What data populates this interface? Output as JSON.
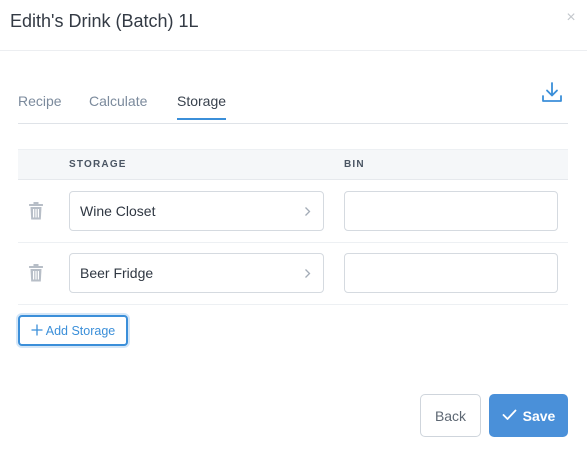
{
  "modal": {
    "title": "Edith's Drink (Batch) 1L",
    "close_glyph": "×"
  },
  "tabs": [
    {
      "label": "Recipe"
    },
    {
      "label": "Calculate"
    },
    {
      "label": "Storage",
      "active": true
    }
  ],
  "table": {
    "headers": {
      "storage": "STORAGE",
      "bin": "BIN"
    },
    "rows": [
      {
        "storage": "Wine Closet",
        "bin": ""
      },
      {
        "storage": "Beer Fridge",
        "bin": ""
      }
    ]
  },
  "actions": {
    "add_storage": "Add Storage",
    "back": "Back",
    "save": "Save"
  },
  "icons": {
    "download": "download-icon",
    "trash": "trash-icon",
    "chevron": "chevron-right-icon",
    "check": "check-icon",
    "plus": "plus-icon",
    "close": "close-icon"
  },
  "colors": {
    "accent": "#3b8fd9",
    "save_bg": "#4a90d9",
    "header_bg": "#f5f7f9"
  }
}
